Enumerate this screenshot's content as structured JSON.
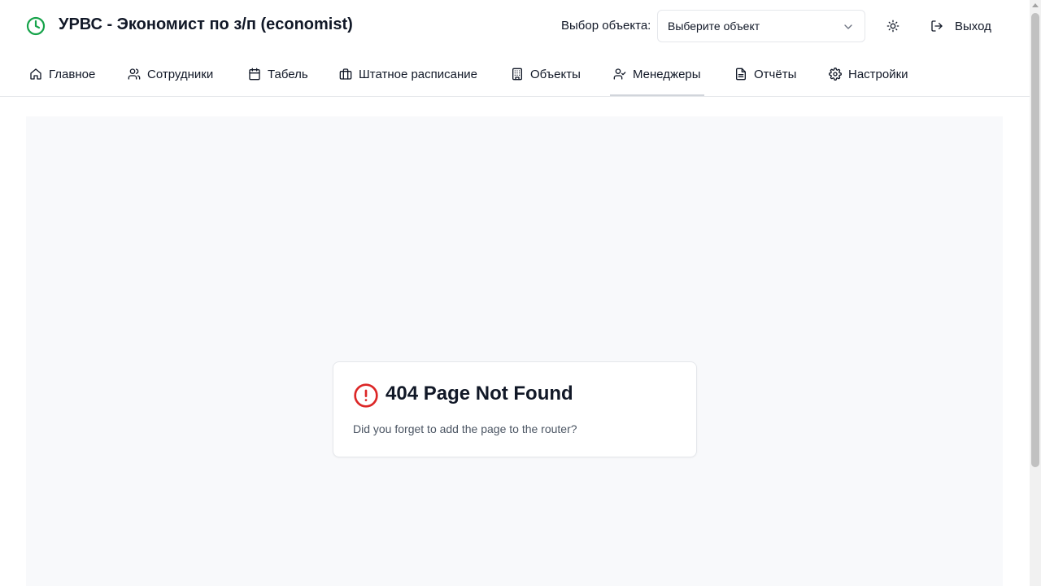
{
  "header": {
    "title": "УРВС - Экономист по з/п (economist)",
    "object_label": "Выбор объекта:",
    "object_select": {
      "value": "Выберите объект"
    },
    "logout_label": "Выход"
  },
  "nav": {
    "tabs": [
      {
        "label": "Главное",
        "icon": "home-icon"
      },
      {
        "label": "Сотрудники",
        "icon": "users-icon"
      },
      {
        "label": "Табель",
        "icon": "calendar-icon"
      },
      {
        "label": "Штатное расписание",
        "icon": "briefcase-icon"
      },
      {
        "label": "Объекты",
        "icon": "building-icon"
      },
      {
        "label": "Менеджеры",
        "icon": "user-check-icon",
        "active": true
      },
      {
        "label": "Отчёты",
        "icon": "file-text-icon"
      },
      {
        "label": "Настройки",
        "icon": "gear-icon"
      }
    ]
  },
  "error": {
    "title": "404 Page Not Found",
    "message": "Did you forget to add the page to the router?"
  },
  "colors": {
    "brand": "#16a34a",
    "error": "#dc2626",
    "main_bg": "#f8f9fb"
  }
}
